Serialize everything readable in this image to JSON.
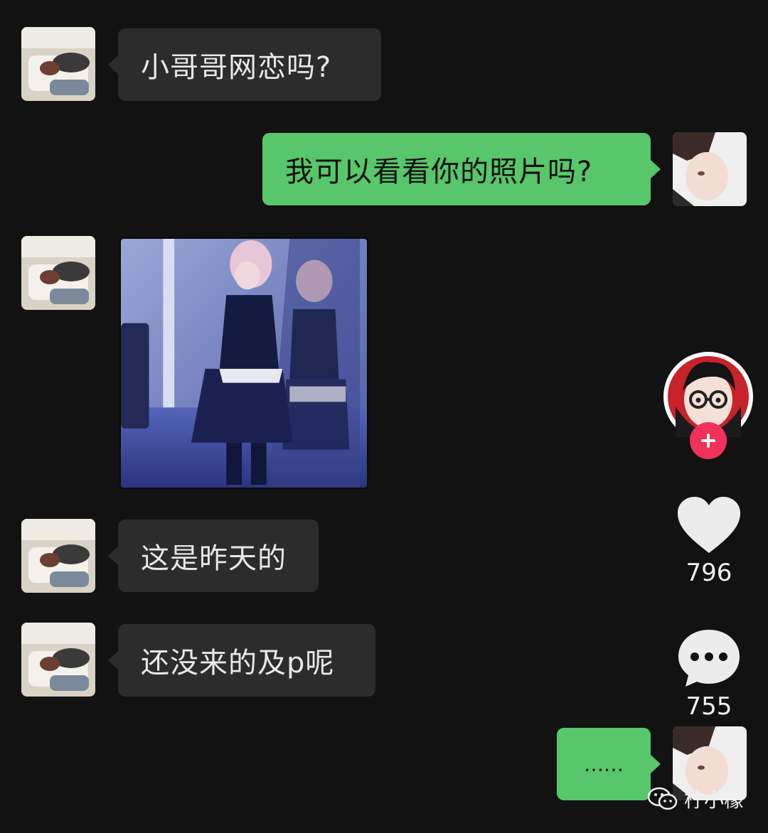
{
  "messages": [
    {
      "side": "left",
      "text": "小哥哥网恋吗?"
    },
    {
      "side": "right",
      "text": "我可以看看你的照片吗?"
    },
    {
      "side": "left",
      "type": "image"
    },
    {
      "side": "left",
      "text": "这是昨天的"
    },
    {
      "side": "left",
      "text": "还没来的及p呢"
    },
    {
      "side": "right",
      "text": "……"
    }
  ],
  "sidebar": {
    "like_count": "796",
    "comment_count": "755"
  },
  "watermark": {
    "text": "柠小檬"
  },
  "colors": {
    "background": "#121212",
    "incoming_bubble": "#2c2c2c",
    "outgoing_bubble": "#58c66a",
    "follow_badge": "#f0315a"
  }
}
